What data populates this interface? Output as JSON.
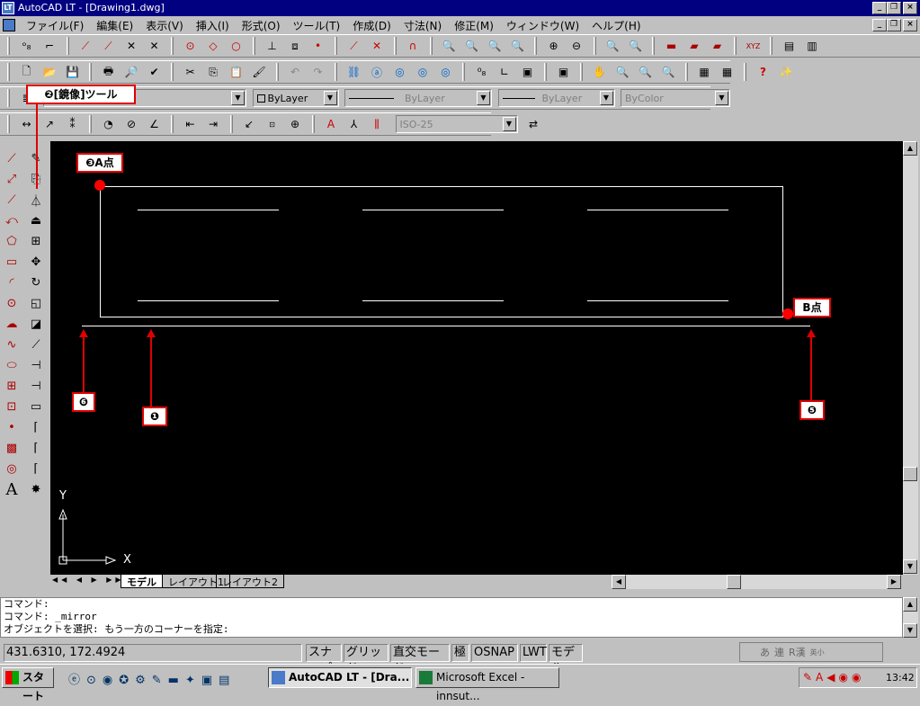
{
  "window": {
    "title": "AutoCAD LT - [Drawing1.dwg]",
    "app_icon": "LT"
  },
  "menu": [
    "ファイル(F)",
    "編集(E)",
    "表示(V)",
    "挿入(I)",
    "形式(O)",
    "ツール(T)",
    "作成(D)",
    "寸法(N)",
    "修正(M)",
    "ウィンドウ(W)",
    "ヘルプ(H)"
  ],
  "properties": {
    "layer_color": "ByLayer",
    "linetype": "ByLayer",
    "lineweight": "ByLayer",
    "plot_style": "ByColor",
    "dim_style": "ISO-25"
  },
  "callouts": {
    "mirror_tool": "❷[鏡像]ツール",
    "point_a": "❸A点",
    "point_b": "B点",
    "c1": "❶",
    "c5": "❺",
    "c6": "❻"
  },
  "ucs": {
    "y": "Y",
    "x": "X"
  },
  "tabs": [
    "モデル",
    "レイアウト1",
    "レイアウト2"
  ],
  "command_lines": [
    "コマンド:",
    "コマンド: _mirror",
    "オブジェクトを選択: もう一方のコーナーを指定:"
  ],
  "status": {
    "coords": "431.6310, 172.4924",
    "snap": "スナップ",
    "grid": "グリッド",
    "ortho": "直交モード",
    "polar": "極",
    "osnap": "OSNAP",
    "lwt": "LWT",
    "model": "モデル"
  },
  "ime": [
    "あ",
    "連",
    "R漢",
    "英小"
  ],
  "taskbar": {
    "start": "スタート",
    "tasks": [
      "AutoCAD LT - [Dra...",
      "Microsoft Excel - innsut..."
    ],
    "clock": "13:42"
  },
  "colors": {
    "title_bar": "#000080",
    "canvas": "#000000",
    "callout_border": "#e00000",
    "point": "#ff0000"
  }
}
